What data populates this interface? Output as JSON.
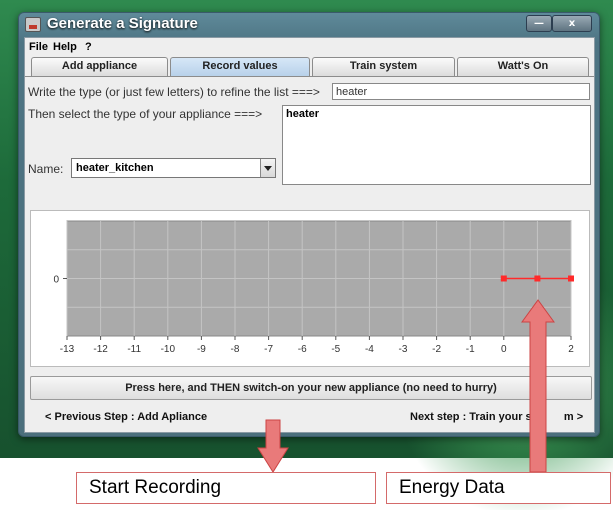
{
  "window": {
    "title": "Generate a Signature",
    "minimize_glyph": "—",
    "close_glyph": "x"
  },
  "menu": {
    "file": "File",
    "help": "Help",
    "question": "?"
  },
  "tabs": [
    {
      "label": "Add appliance"
    },
    {
      "label": "Record values"
    },
    {
      "label": "Train system"
    },
    {
      "label": "Watt's On"
    }
  ],
  "form": {
    "type_prompt": "Write the type (or just few letters) to refine the list  ===>",
    "type_value": "heater",
    "select_prompt": "Then select the type of your appliance  ===>",
    "list_items": [
      "heater"
    ],
    "name_label": "Name:",
    "name_value": "heater_kitchen"
  },
  "chart_data": {
    "type": "line",
    "x_ticks": [
      "-13",
      "-12",
      "-11",
      "-10",
      "-9",
      "-8",
      "-7",
      "-6",
      "-5",
      "-4",
      "-3",
      "-2",
      "-1",
      "0",
      "1",
      "2"
    ],
    "y_ticks": [
      "0"
    ],
    "xlim": [
      -13,
      2
    ],
    "ylim": [
      -1,
      1
    ],
    "series": [
      {
        "x": [
          0,
          1,
          2
        ],
        "y": [
          0,
          0,
          0
        ],
        "color": "#ff2a2a"
      }
    ],
    "plot_bg": "#aaaaaa",
    "grid": true
  },
  "record_button": "Press here, and THEN switch-on your new appliance (no need to hurry)",
  "nav": {
    "prev": "<  Previous Step : Add Apliance",
    "next": "Next step : Train your sys",
    "next_tail": "m  >"
  },
  "annotations": {
    "start_recording": "Start Recording",
    "energy_data": "Energy Data",
    "arrow_color": "#e06a6a"
  }
}
